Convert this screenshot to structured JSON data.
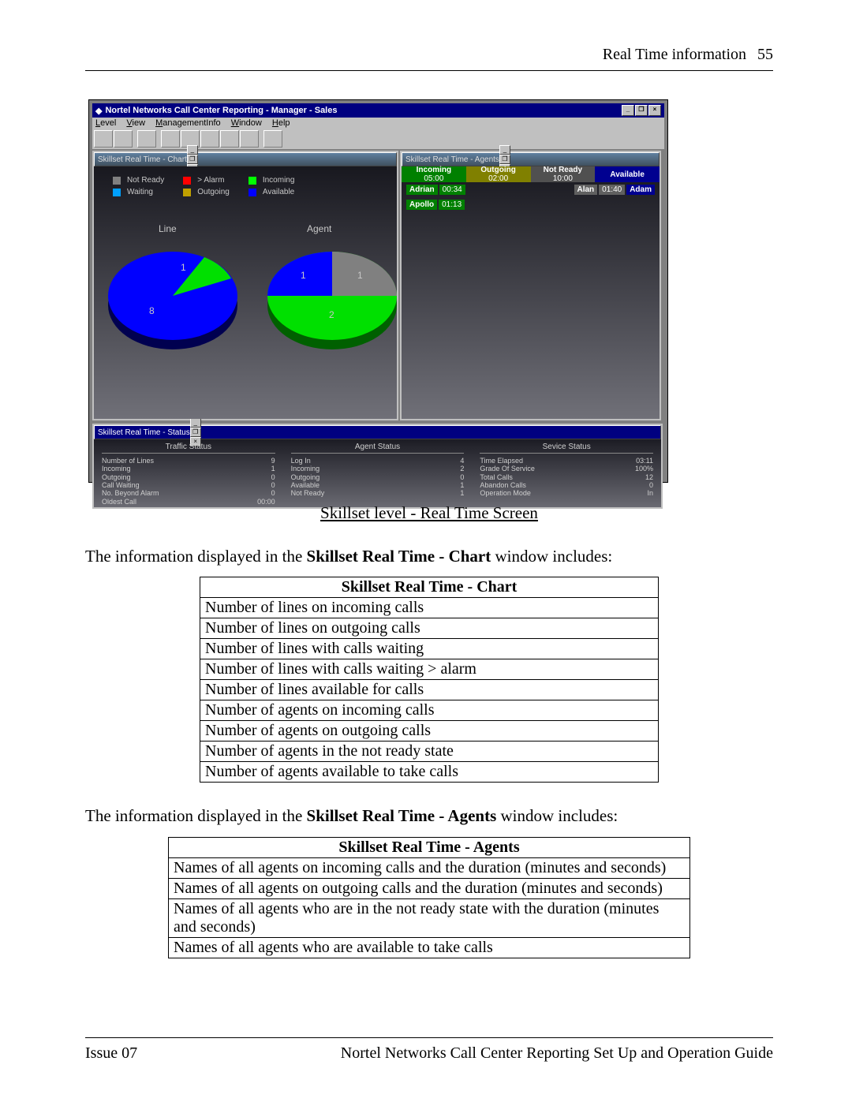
{
  "header": {
    "section": "Real Time information",
    "page": "55"
  },
  "app": {
    "title": "Nortel Networks Call Center Reporting - Manager - Sales",
    "menus": [
      "Level",
      "View",
      "ManagementInfo",
      "Window",
      "Help"
    ]
  },
  "chart_win": {
    "title": "Skillset Real Time - Chart",
    "legend": {
      "not_ready": "Not Ready",
      "alarm": "> Alarm",
      "incoming": "Incoming",
      "waiting": "Waiting",
      "outgoing": "Outgoing",
      "available": "Available"
    },
    "labels": {
      "line": "Line",
      "agent": "Agent"
    }
  },
  "agents_win": {
    "title": "Skillset Real Time - Agents",
    "cols": {
      "incoming": {
        "label": "Incoming",
        "time": "05:00"
      },
      "outgoing": {
        "label": "Outgoing",
        "time": "02:00"
      },
      "not_ready": {
        "label": "Not Ready",
        "time": "10:00"
      },
      "available": {
        "label": "Available",
        "time": ""
      }
    },
    "rows": {
      "adrian": {
        "name": "Adrian",
        "time": "00:34"
      },
      "apollo": {
        "name": "Apollo",
        "time": "01:13"
      },
      "alan": {
        "name": "Alan",
        "time": "01:40"
      },
      "adam": {
        "name": "Adam",
        "time": ""
      }
    }
  },
  "status_win": {
    "title": "Skillset Real Time - Status",
    "traffic": {
      "title": "Traffic Status",
      "rows": [
        {
          "k": "Number of Lines",
          "v": "9"
        },
        {
          "k": "Incoming",
          "v": "1"
        },
        {
          "k": "Outgoing",
          "v": "0"
        },
        {
          "k": "Call Waiting",
          "v": "0"
        },
        {
          "k": "No. Beyond Alarm",
          "v": "0"
        },
        {
          "k": "Oldest Call",
          "v": "00:00"
        }
      ]
    },
    "agent": {
      "title": "Agent Status",
      "rows": [
        {
          "k": "Log In",
          "v": "4"
        },
        {
          "k": "Incoming",
          "v": "2"
        },
        {
          "k": "Outgoing",
          "v": "0"
        },
        {
          "k": "Available",
          "v": "1"
        },
        {
          "k": "Not Ready",
          "v": "1"
        }
      ]
    },
    "service": {
      "title": "Sevice Status",
      "rows": [
        {
          "k": "Time Elapsed",
          "v": "03:11"
        },
        {
          "k": "Grade Of Service",
          "v": "100%"
        },
        {
          "k": "Total Calls",
          "v": "12"
        },
        {
          "k": "Abandon Calls",
          "v": "0"
        },
        {
          "k": "Operation Mode",
          "v": "In"
        }
      ]
    }
  },
  "chart_data": [
    {
      "type": "pie",
      "title": "Line",
      "series": [
        {
          "name": "Available",
          "values": [
            8
          ]
        },
        {
          "name": "Incoming",
          "values": [
            1
          ]
        }
      ],
      "labels": [
        "8",
        "1"
      ]
    },
    {
      "type": "pie",
      "title": "Agent",
      "series": [
        {
          "name": "Available",
          "values": [
            1
          ]
        },
        {
          "name": "Not Ready",
          "values": [
            1
          ]
        },
        {
          "name": "Incoming",
          "values": [
            2
          ]
        }
      ],
      "labels": [
        "1",
        "1",
        "2"
      ]
    }
  ],
  "caption": "Skillset level - Real Time Screen",
  "para1_a": "The information displayed in the ",
  "para1_b": "Skillset Real Time - Chart",
  "para1_c": " window includes:",
  "table1": {
    "header": "Skillset Real Time - Chart",
    "rows": [
      "Number of lines on incoming calls",
      "Number of lines on outgoing calls",
      "Number of lines with calls waiting",
      "Number of lines with calls waiting > alarm",
      "Number of lines available for calls",
      "Number of agents on incoming calls",
      "Number of agents on outgoing calls",
      "Number of agents in the not ready state",
      "Number of agents available to take calls"
    ]
  },
  "para2_a": "The information displayed in the ",
  "para2_b": "Skillset Real Time - Agents",
  "para2_c": " window includes:",
  "table2": {
    "header": "Skillset Real Time - Agents",
    "rows": [
      "Names of all agents on incoming calls and the duration (minutes and seconds)",
      "Names of all agents on outgoing calls and the duration (minutes and seconds)",
      "Names of all agents who are in the not ready state with the duration (minutes and seconds)",
      "Names of all agents who are available to take calls"
    ]
  },
  "footer": {
    "left": "Issue 07",
    "right": "Nortel Networks Call Center Reporting Set Up and Operation Guide"
  }
}
